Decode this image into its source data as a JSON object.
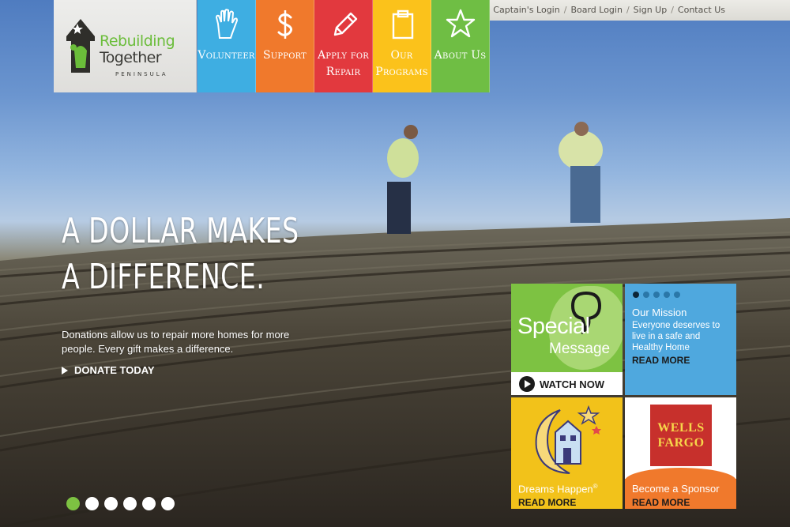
{
  "top_links": [
    "Captain's Login",
    "Board Login",
    "Sign Up",
    "Contact Us"
  ],
  "logo": {
    "line1": "Rebuilding",
    "line2": "Together",
    "line3": "PENINSULA"
  },
  "nav": [
    {
      "label": "Volunteer",
      "color": "#3eaee2",
      "icon": "hand-icon"
    },
    {
      "label": "Support",
      "color": "#f0792c",
      "icon": "dollar-icon"
    },
    {
      "label": "Apply for Repair",
      "color": "#e2393e",
      "icon": "pencil-icon"
    },
    {
      "label": "Our Programs",
      "color": "#fbc21b",
      "icon": "clipboard-icon"
    },
    {
      "label": "About Us",
      "color": "#6fbe44",
      "icon": "star-icon"
    }
  ],
  "hero": {
    "headline": "A dollar makes a difference.",
    "subtext": "Donations allow us to repair more homes for more people. Every gift makes a difference.",
    "cta": "DONATE TODAY",
    "dots": 6,
    "active_dot": 0
  },
  "tiles": {
    "special": {
      "line1": "Special",
      "line2": "Message",
      "cta": "WATCH NOW"
    },
    "mission": {
      "title": "Our Mission",
      "body": "Everyone deserves to live in a safe and Healthy Home",
      "cta": "READ MORE",
      "dots": 5,
      "active_dot": 0
    },
    "dreams": {
      "label": "Dreams Happen",
      "mark": "®",
      "cta": "READ MORE"
    },
    "sponsor": {
      "logo_line1": "WELLS",
      "logo_line2": "FARGO",
      "label": "Become a Sponsor",
      "cta": "READ MORE"
    }
  },
  "colors": {
    "green": "#7dc242",
    "blue": "#4fa8de",
    "yellow": "#f2c21a",
    "orange": "#f0792c",
    "red": "#e2393e"
  }
}
